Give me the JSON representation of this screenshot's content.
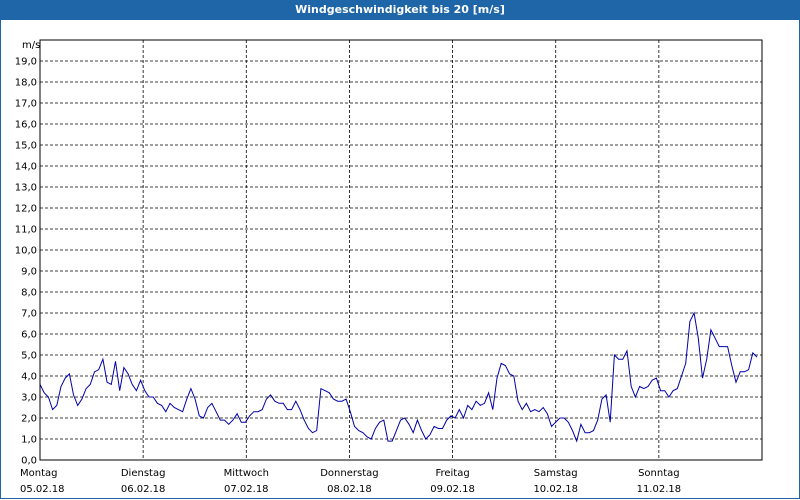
{
  "chart_data": {
    "type": "line",
    "title": "Windgeschwindigkeit bis 20 [m/s]",
    "ylabel": "m/s",
    "xlabel": "",
    "ylim": [
      0,
      20
    ],
    "yticks": [
      "0,0",
      "1,0",
      "2,0",
      "3,0",
      "4,0",
      "5,0",
      "6,0",
      "7,0",
      "8,0",
      "9,0",
      "10,0",
      "11,0",
      "12,0",
      "13,0",
      "14,0",
      "15,0",
      "16,0",
      "17,0",
      "18,0",
      "19,0"
    ],
    "xlim_days": 7,
    "days": [
      {
        "name": "Montag",
        "date": "05.02.18"
      },
      {
        "name": "Dienstag",
        "date": "06.02.18"
      },
      {
        "name": "Mittwoch",
        "date": "07.02.18"
      },
      {
        "name": "Donnerstag",
        "date": "08.02.18"
      },
      {
        "name": "Freitag",
        "date": "09.02.18"
      },
      {
        "name": "Samstag",
        "date": "10.02.18"
      },
      {
        "name": "Sonntag",
        "date": "11.02.18"
      }
    ],
    "grid": true,
    "line_color": "#0000aa",
    "series": [
      {
        "values": [
          3.6,
          3.2,
          3.0,
          2.4,
          2.6,
          3.5,
          3.9,
          4.1,
          3.1,
          2.6,
          2.9,
          3.4,
          3.6,
          4.2,
          4.3,
          4.8,
          3.7,
          3.6,
          4.7,
          3.3,
          4.4,
          4.1,
          3.6,
          3.3,
          3.8,
          3.3,
          3.0,
          3.0,
          2.7,
          2.6,
          2.3,
          2.7,
          2.5,
          2.4,
          2.3,
          2.9,
          3.4,
          2.9,
          2.1,
          2.0,
          2.5,
          2.7,
          2.3,
          1.9,
          1.9,
          1.7,
          1.9,
          2.2,
          1.8,
          1.8,
          2.1,
          2.3,
          2.3,
          2.4,
          2.9,
          3.1,
          2.8,
          2.7,
          2.7,
          2.4,
          2.4,
          2.8,
          2.4,
          1.9,
          1.5,
          1.3,
          1.4,
          3.4,
          3.3,
          3.2,
          2.9,
          2.8,
          2.8,
          2.9,
          2.3,
          1.6,
          1.4,
          1.3,
          1.1,
          1.0,
          1.5,
          1.8,
          1.9,
          0.9,
          0.9,
          1.4,
          1.9,
          2.0,
          1.7,
          1.3,
          1.9,
          1.4,
          1.0,
          1.2,
          1.6,
          1.5,
          1.5,
          1.9,
          2.1,
          2.0,
          2.4,
          2.0,
          2.6,
          2.4,
          2.8,
          2.6,
          2.7,
          3.2,
          2.4,
          3.9,
          4.6,
          4.5,
          4.1,
          4.0,
          2.8,
          2.4,
          2.7,
          2.3,
          2.4,
          2.3,
          2.5,
          2.2,
          1.6,
          1.8,
          2.0,
          2.0,
          1.8,
          1.4,
          0.9,
          1.7,
          1.3,
          1.3,
          1.4,
          1.9,
          2.9,
          3.1,
          1.8,
          5.0,
          4.8,
          4.8,
          5.2,
          3.5,
          3.0,
          3.5,
          3.4,
          3.5,
          3.8,
          3.9,
          3.3,
          3.3,
          3.0,
          3.3,
          3.4,
          4.0,
          4.6,
          6.6,
          7.0,
          5.8,
          3.9,
          4.8,
          6.2,
          5.8,
          5.4,
          5.4,
          5.4,
          4.5,
          3.7,
          4.2,
          4.2,
          4.3,
          5.1,
          4.9
        ]
      }
    ]
  }
}
